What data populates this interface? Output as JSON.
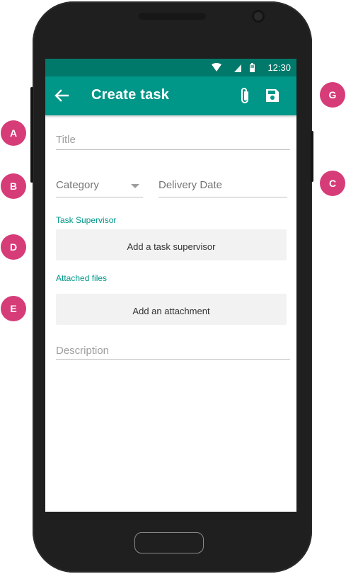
{
  "status_bar": {
    "time": "12:30"
  },
  "app_bar": {
    "title": "Create task"
  },
  "form": {
    "title_placeholder": "Title",
    "category_placeholder": "Category",
    "delivery_date_placeholder": "Delivery Date",
    "task_supervisor_label": "Task Supervisor",
    "add_supervisor_label": "Add a task supervisor",
    "attached_files_label": "Attached files",
    "add_attachment_label": "Add an attachment",
    "description_placeholder": "Description"
  },
  "callouts": {
    "a": "A",
    "b": "B",
    "c": "C",
    "d": "D",
    "e": "E",
    "g": "G"
  },
  "colors": {
    "primary": "#009688",
    "primary_dark": "#00796b",
    "callout": "#d63c78"
  },
  "icons": [
    "back-arrow-icon",
    "paperclip-icon",
    "save-icon",
    "wifi-icon",
    "signal-icon",
    "battery-icon",
    "dropdown-arrow-icon"
  ]
}
